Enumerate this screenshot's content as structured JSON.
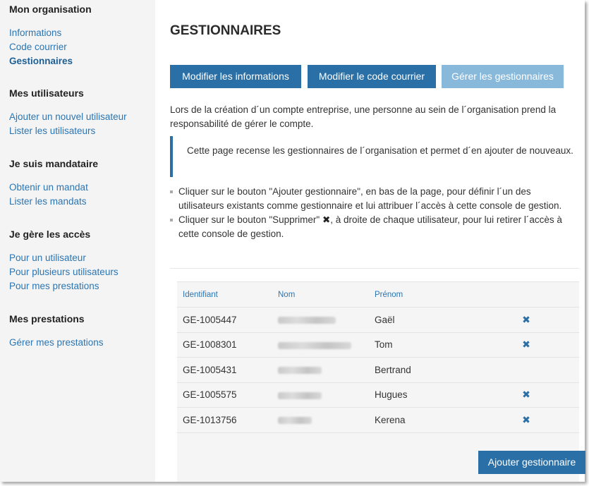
{
  "sidebar": {
    "sections": [
      {
        "heading": "Mon organisation",
        "links": [
          "Informations",
          "Code courrier",
          "Gestionnaires"
        ]
      },
      {
        "heading": "Mes utilisateurs",
        "links": [
          "Ajouter un nouvel utilisateur",
          "Lister les utilisateurs"
        ]
      },
      {
        "heading": "Je suis mandataire",
        "links": [
          "Obtenir un mandat",
          "Lister les mandats"
        ]
      },
      {
        "heading": "Je gère les accès",
        "links": [
          "Pour un utilisateur",
          "Pour plusieurs utilisateurs",
          "Pour mes prestations"
        ]
      },
      {
        "heading": "Mes prestations",
        "links": [
          "Gérer mes prestations"
        ]
      }
    ],
    "active_link": "Gestionnaires"
  },
  "main": {
    "title": "GESTIONNAIRES",
    "buttons": {
      "modify_info": "Modifier les informations",
      "modify_code": "Modifier le code courrier",
      "manage": "Gérer les gestionnaires"
    },
    "intro": "Lors de la création d´un compte entreprise, une personne au sein de l´organisation prend la responsabilité de gérer le compte.",
    "callout": "Cette page recense les gestionnaires de l´organisation et permet d´en ajouter de nouveaux.",
    "bullet1": "Cliquer sur le bouton \"Ajouter gestionnaire\", en bas de la page, pour définir l´un des utilisateurs existants comme gestionnaire et lui attribuer l´accès à cette console de gestion.",
    "bullet2_before": "Cliquer sur le bouton \"Supprimer\" ",
    "bullet2_icon": "✖",
    "bullet2_after": ", à droite de chaque utilisateur, pour lui retirer l´accès à cette console de gestion."
  },
  "table": {
    "headers": {
      "id": "Identifiant",
      "nom": "Nom",
      "prenom": "Prénom"
    },
    "rows": [
      {
        "id": "GE-1005447",
        "prenom": "Gaël",
        "deletable": true
      },
      {
        "id": "GE-1008301",
        "prenom": "Tom",
        "deletable": true
      },
      {
        "id": "GE-1005431",
        "prenom": "Bertrand",
        "deletable": false
      },
      {
        "id": "GE-1005575",
        "prenom": "Hugues",
        "deletable": true
      },
      {
        "id": "GE-1013756",
        "prenom": "Kerena",
        "deletable": true
      }
    ],
    "delete_icon": "✖",
    "add_label": "Ajouter gestionnaire"
  },
  "colors": {
    "primary": "#2a6fa6",
    "disabled": "#88b8da",
    "link": "#2a75b3",
    "sidebar_bg": "#f4f4f4"
  }
}
